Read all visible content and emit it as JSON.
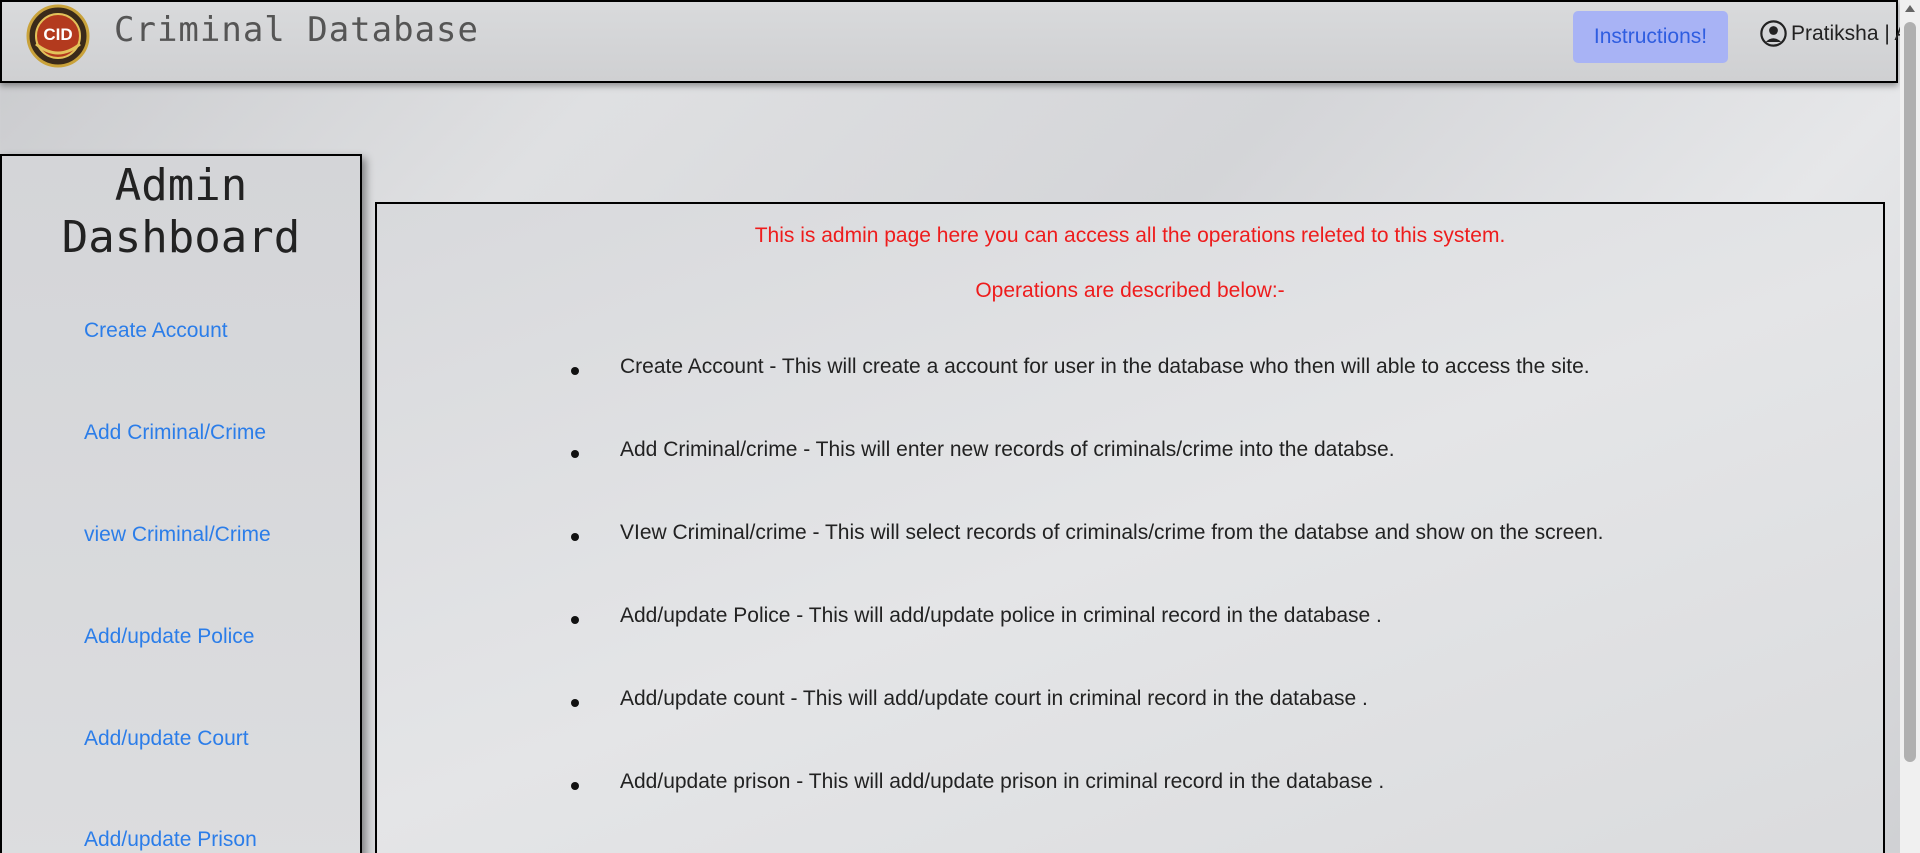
{
  "navbar": {
    "logo_text": "CID",
    "title": "Criminal Database",
    "instructions_label": "Instructions!",
    "user_label": "Pratiksha | A"
  },
  "sidebar": {
    "title": "Admin Dashboard",
    "items": [
      {
        "label": "Create Account"
      },
      {
        "label": "Add Criminal/Crime"
      },
      {
        "label": "view Criminal/Crime"
      },
      {
        "label": "Add/update Police"
      },
      {
        "label": "Add/update Court"
      },
      {
        "label": "Add/update Prison"
      }
    ]
  },
  "main": {
    "intro": "This is admin page here you can access all the operations releted to this system.",
    "subheading": "Operations are described below:-",
    "operations": [
      "Create Account - This will create a account for user in the database who then will able to access the site.",
      "Add Criminal/crime - This will enter new records of criminals/crime into the databse.",
      "VIew Criminal/crime - This will select records of criminals/crime from the databse and show on the screen.",
      "Add/update Police - This will add/update police in criminal record in the database .",
      "Add/update count - This will add/update court in criminal record in the database .",
      "Add/update prison - This will add/update prison in criminal record in the database ."
    ]
  },
  "colors": {
    "link": "#2b7de9",
    "alert_text": "#ee1c1c",
    "button_bg": "#a8b3f5"
  },
  "icons": {
    "logo": "cid-badge-logo",
    "user": "user-circle-icon"
  }
}
